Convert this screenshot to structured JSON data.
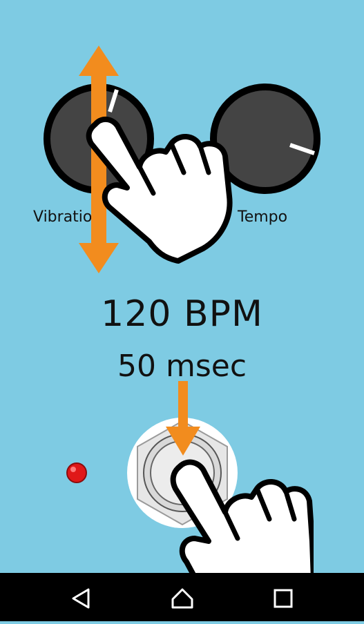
{
  "knobs": [
    {
      "label": "Vibration",
      "indicator_angle_deg": 20
    },
    {
      "label": "Tempo",
      "indicator_angle_deg": 110
    }
  ],
  "display": {
    "bpm": "120 BPM",
    "msec": "50 msec"
  },
  "led": {
    "color": "#e01818",
    "state": "on"
  },
  "colors": {
    "background": "#7ecbe3",
    "knob": "#444444",
    "arrow": "#f28c1e"
  },
  "navbar": {
    "buttons": [
      "back-icon",
      "home-icon",
      "recents-icon"
    ]
  }
}
